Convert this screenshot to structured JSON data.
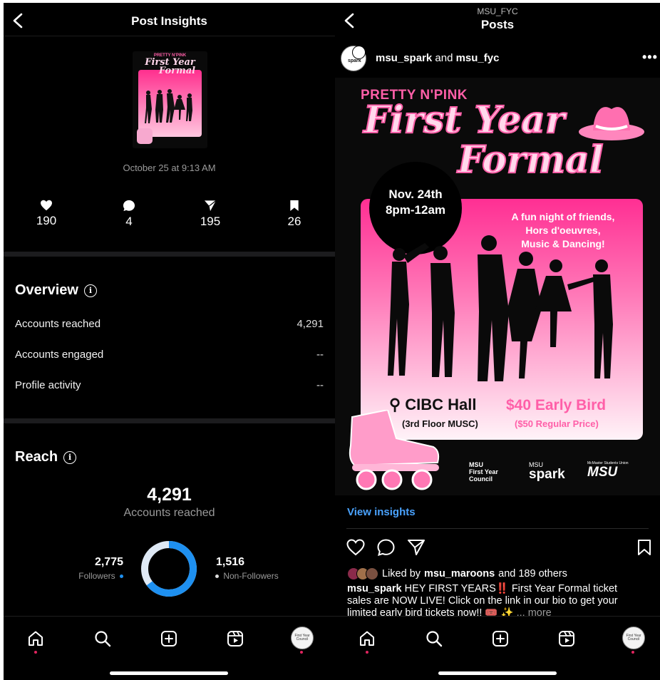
{
  "left": {
    "header_title": "Post Insights",
    "timestamp": "October 25 at 9:13 AM",
    "stats": [
      {
        "icon": "heart-icon",
        "value": "190"
      },
      {
        "icon": "comment-icon",
        "value": "4"
      },
      {
        "icon": "share-icon",
        "value": "195"
      },
      {
        "icon": "bookmark-icon",
        "value": "26"
      }
    ],
    "overview": {
      "title": "Overview",
      "rows": [
        {
          "label": "Accounts reached",
          "value": "4,291"
        },
        {
          "label": "Accounts engaged",
          "value": "--"
        },
        {
          "label": "Profile activity",
          "value": "--"
        }
      ]
    },
    "reach": {
      "title": "Reach",
      "total": "4,291",
      "total_label": "Accounts reached",
      "followers_value": "2,775",
      "followers_label": "Followers",
      "nonfollowers_value": "1,516",
      "nonfollowers_label": "Non-Followers",
      "followers_fraction": 0.647,
      "followers_color": "#1e90f0",
      "nonfollowers_color": "#dfe9f5"
    }
  },
  "right": {
    "header_subtitle": "MSU_FYC",
    "header_title": "Posts",
    "post_author_a": "msu_spark",
    "post_author_join": "and",
    "post_author_b": "msu_fyc",
    "avatar_label": "spark",
    "poster": {
      "kicker": "PRETTY N'PINK",
      "title_line1": "First Year",
      "title_line2": "Formal",
      "date_line1": "Nov. 24th",
      "date_line2": "8pm-12am",
      "tagline_1": "A fun night of friends,",
      "tagline_2": "Hors d'oeuvres,",
      "tagline_3": "Music & Dancing!",
      "venue": "CIBC Hall",
      "venue_sub": "(3rd Floor MUSC)",
      "price": "$40 Early Bird",
      "price_sub": "($50 Regular Price)",
      "logo1_a": "MSU",
      "logo1_b": "First Year",
      "logo1_c": "Council",
      "logo2_a": "MSU",
      "logo2_b": "spark",
      "logo3_a": "McMaster Students Union",
      "logo3_b": "MSU"
    },
    "view_insights": "View insights",
    "liked_prefix": "Liked by",
    "liked_user": "msu_maroons",
    "liked_suffix": "and 189 others",
    "caption_user": "msu_spark",
    "caption_l1": "HEY FIRST YEARS‼️ First Year Formal ticket",
    "caption_l2": "sales are NOW LIVE! Click on the link in our bio to get your",
    "caption_l3": "limited early bird tickets now!! 🎟️ ✨",
    "caption_more": "... more"
  },
  "thumb": {
    "kicker": "PRETTY N'PINK",
    "title_line1": "First Year",
    "title_line2": "Formal"
  },
  "nav": {
    "items": [
      "home-icon",
      "search-icon",
      "create-icon",
      "reels-icon",
      "profile-avatar"
    ],
    "profile_label": "First Year Council"
  }
}
